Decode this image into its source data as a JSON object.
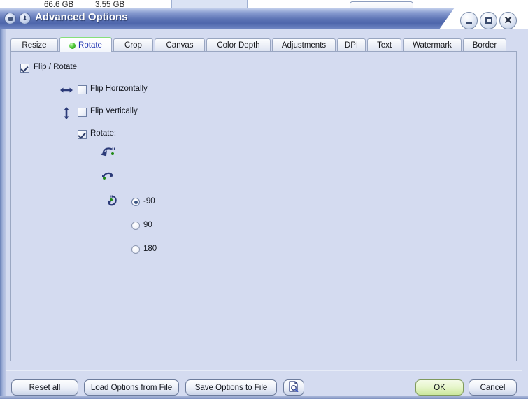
{
  "background": {
    "size_1": "66.6 GB",
    "size_2": "3.55 GB",
    "dots_button": "..."
  },
  "window": {
    "title": "Advanced Options",
    "icons": {
      "app_icon": "square-icon",
      "sort-icon": "up-down-chevron-icon"
    },
    "controls": {
      "minimize": "minimize-icon",
      "maximize": "maximize-icon",
      "close": "close-icon"
    }
  },
  "tabs": [
    {
      "label": "Resize",
      "active": false
    },
    {
      "label": "Rotate",
      "active": true
    },
    {
      "label": "Crop",
      "active": false
    },
    {
      "label": "Canvas",
      "active": false
    },
    {
      "label": "Color Depth",
      "active": false
    },
    {
      "label": "Adjustments",
      "active": false
    },
    {
      "label": "DPI",
      "active": false
    },
    {
      "label": "Text",
      "active": false
    },
    {
      "label": "Watermark",
      "active": false
    },
    {
      "label": "Border",
      "active": false
    }
  ],
  "panel": {
    "group_checkbox": {
      "label": "Flip / Rotate",
      "checked": true
    },
    "options": [
      {
        "label": "Flip Horizontally",
        "checked": false,
        "icon": "flip-horizontal-icon"
      },
      {
        "label": "Flip Vertically",
        "checked": false,
        "icon": "flip-vertical-icon"
      },
      {
        "label": "Rotate:",
        "checked": true,
        "icon": "none"
      }
    ],
    "rotate_options": [
      {
        "label": "-90",
        "selected": true,
        "icon": "rotate-left-icon"
      },
      {
        "label": "90",
        "selected": false,
        "icon": "rotate-right-icon"
      },
      {
        "label": "180",
        "selected": false,
        "icon": "rotate-180-icon"
      }
    ]
  },
  "footer": {
    "reset_all": "Reset all",
    "load_options": "Load Options from File",
    "save_options": "Save Options to File",
    "preview": "preview-icon",
    "ok": "OK",
    "cancel": "Cancel"
  },
  "colors": {
    "dialog_body": "#d4dbf0",
    "titlebar_blue": "#5d74b5",
    "active_tab_text": "#1d32b0",
    "active_tab_dot": "#2f9c1f",
    "ok_button_green": "#d8eeb2",
    "icon_navy": "#2b3a78"
  }
}
